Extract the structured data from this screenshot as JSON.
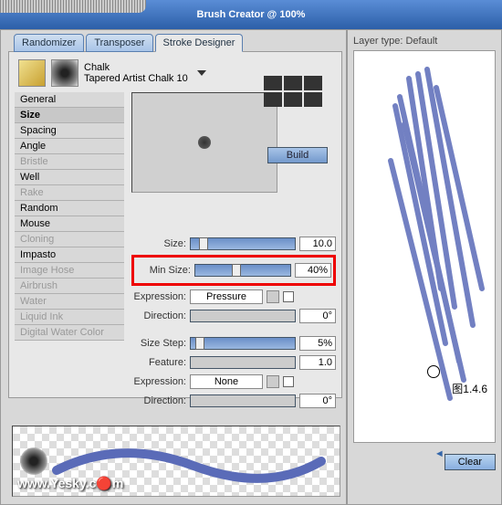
{
  "title": "Brush Creator @ 100%",
  "tabs": [
    "Randomizer",
    "Transposer",
    "Stroke Designer"
  ],
  "activeTab": 2,
  "brush": {
    "name": "Chalk",
    "variant": "Tapered Artist Chalk 10"
  },
  "categories": [
    {
      "label": "General",
      "enabled": true
    },
    {
      "label": "Size",
      "enabled": true,
      "selected": true
    },
    {
      "label": "Spacing",
      "enabled": true
    },
    {
      "label": "Angle",
      "enabled": true
    },
    {
      "label": "Bristle",
      "enabled": false
    },
    {
      "label": "Well",
      "enabled": true
    },
    {
      "label": "Rake",
      "enabled": false
    },
    {
      "label": "Random",
      "enabled": true
    },
    {
      "label": "Mouse",
      "enabled": true
    },
    {
      "label": "Cloning",
      "enabled": false
    },
    {
      "label": "Impasto",
      "enabled": true
    },
    {
      "label": "Image Hose",
      "enabled": false
    },
    {
      "label": "Airbrush",
      "enabled": false
    },
    {
      "label": "Water",
      "enabled": false
    },
    {
      "label": "Liquid Ink",
      "enabled": false
    },
    {
      "label": "Digital Water Color",
      "enabled": false
    }
  ],
  "buildLabel": "Build",
  "controls": {
    "sizeLabel": "Size:",
    "sizeVal": "10.0",
    "minSizeLabel": "Min Size:",
    "minSizeVal": "40%",
    "expr1Label": "Expression:",
    "expr1Val": "Pressure",
    "dir1Label": "Direction:",
    "dir1Val": "0°",
    "stepLabel": "Size Step:",
    "stepVal": "5%",
    "featLabel": "Feature:",
    "featVal": "1.0",
    "expr2Label": "Expression:",
    "expr2Val": "None",
    "dir2Label": "Direction:",
    "dir2Val": "0°"
  },
  "layerType": "Layer type: Default",
  "figLabel": "图1.4.6",
  "clearLabel": "Clear",
  "watermark": "www.Yesky.c🔴m"
}
